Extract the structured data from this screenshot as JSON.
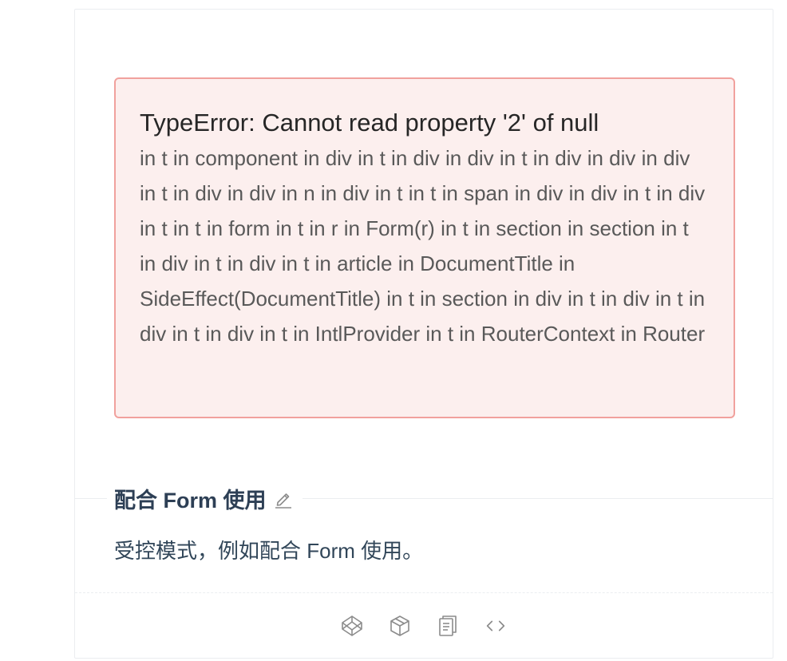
{
  "error": {
    "title": "TypeError: Cannot read property '2' of null",
    "stack": "in t in component in div in t in div in div in t in div in div in div in t in div in div in n in div in t in t in span in div in div in t in div in t in t in form in t in r in Form(r) in t in section in section in t in div in t in div in t in article in DocumentTitle in SideEffect(DocumentTitle) in t in section in div in t in div in t in div in t in div in t in IntlProvider in t in RouterContext in Router"
  },
  "demo": {
    "title": "配合 Form 使用",
    "description": "受控模式，例如配合 Form 使用。"
  },
  "icons": {
    "edit": "edit-icon",
    "codepen": "codepen-icon",
    "codesandbox": "codesandbox-icon",
    "copy": "copy-icon",
    "expand_code": "code-expand-icon"
  },
  "colors": {
    "error_bg": "#fcefee",
    "error_border": "#f1a19d",
    "icon": "#8c8c8c",
    "title": "#2d3f55"
  }
}
